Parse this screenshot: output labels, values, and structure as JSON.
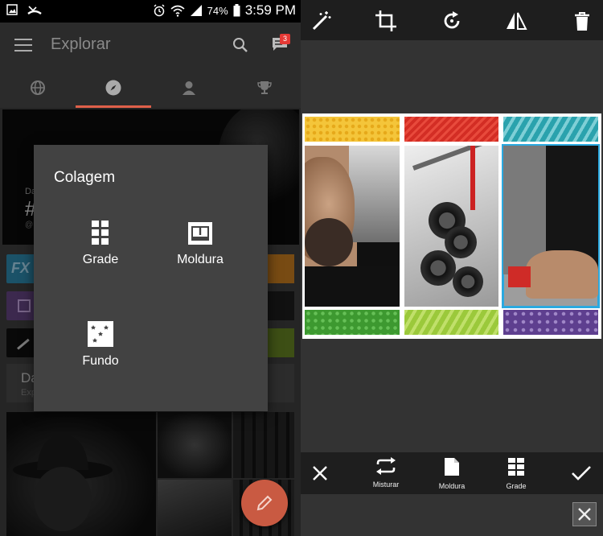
{
  "status_bar": {
    "battery_percent": "74%",
    "time": "3:59 PM",
    "icons": [
      "image-notification-icon",
      "missed-call-icon",
      "alarm-icon",
      "wifi-icon",
      "signal-icon",
      "battery-icon"
    ]
  },
  "app_bar": {
    "title": "Explorar",
    "notification_count": "3",
    "icons": [
      "menu-icon",
      "search-icon",
      "chat-icon"
    ]
  },
  "tabs": [
    {
      "icon": "globe-icon",
      "active": false
    },
    {
      "icon": "compass-icon",
      "active": true
    },
    {
      "icon": "person-icon",
      "active": false
    },
    {
      "icon": "trophy-icon",
      "active": false
    }
  ],
  "feed": {
    "hero": {
      "caption_top": "Da",
      "hashtag": "#",
      "handle": "@"
    },
    "rows": [
      {
        "label": "FX",
        "color": "#2a7fa0",
        "accent": "#b8741e"
      },
      {
        "label": "",
        "color": "#5d3f78",
        "accent": "#1b1b1b"
      },
      {
        "label": "",
        "color": "#0f0f0f",
        "accent": "#5e7a21"
      }
    ],
    "card": {
      "title": "Da",
      "subtitle": "Exp"
    }
  },
  "dialog": {
    "title": "Colagem",
    "options": [
      {
        "label": "Grade",
        "icon": "grid-icon"
      },
      {
        "label": "Moldura",
        "icon": "frame-icon"
      },
      {
        "label": "Fundo",
        "icon": "background-icon"
      }
    ]
  },
  "fab": {
    "icon": "pencil-icon",
    "color": "#c95a42"
  },
  "editor": {
    "top_tools": [
      "magic-wand-icon",
      "crop-icon",
      "rotate-icon",
      "flip-icon",
      "trash-icon"
    ],
    "bottom_tools": [
      {
        "label": "",
        "icon": "close-icon"
      },
      {
        "label": "Misturar",
        "icon": "shuffle-icon"
      },
      {
        "label": "Moldura",
        "icon": "frame-doc-icon"
      },
      {
        "label": "Grade",
        "icon": "grid-icon"
      },
      {
        "label": "",
        "icon": "check-icon"
      }
    ],
    "strip_colors_top": [
      "#f4c53a",
      "#d32d24",
      "#2aa2ad"
    ],
    "strip_colors_bottom": [
      "#3d9930",
      "#9bc93b",
      "#5e3f8f"
    ],
    "selection_color": "#2aa9e0"
  },
  "accent": "#e0604a"
}
